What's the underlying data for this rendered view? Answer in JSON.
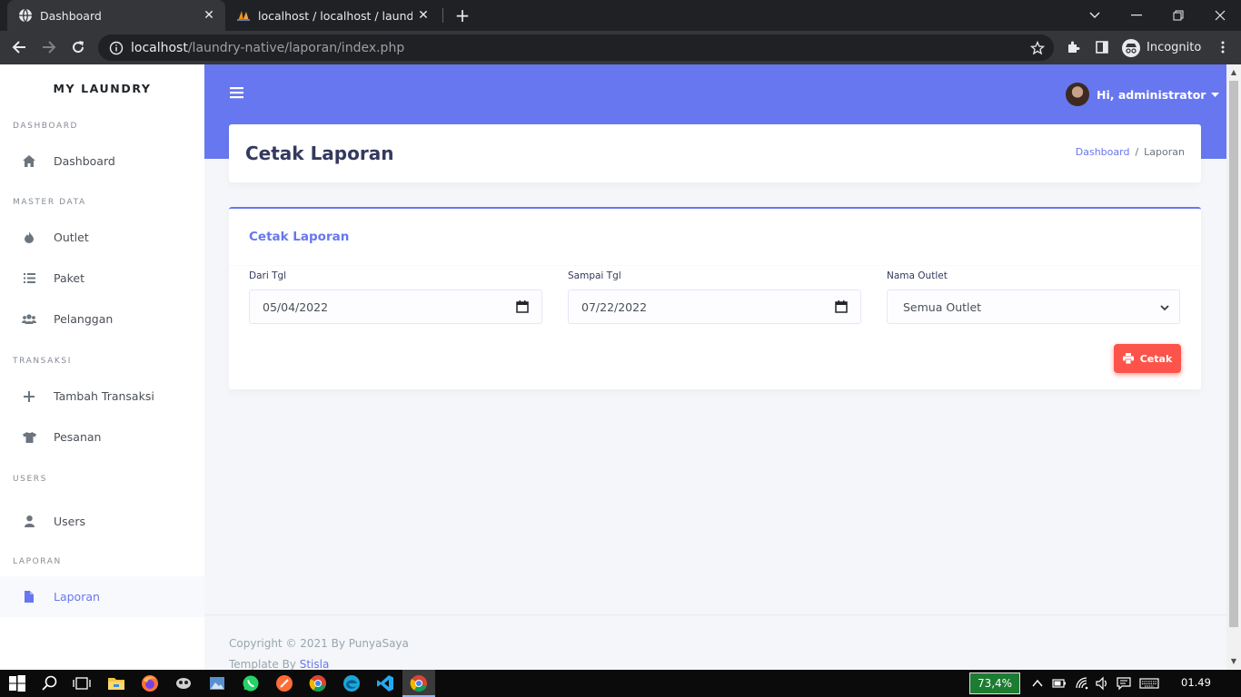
{
  "browser": {
    "tabs": [
      {
        "title": "Dashboard",
        "icon": "globe-icon",
        "active": true
      },
      {
        "title": "localhost / localhost / laundry-na",
        "icon": "phpmyadmin-icon",
        "active": false
      }
    ],
    "url_host": "localhost",
    "url_path": "/laundry-native/laporan/index.php",
    "profile_label": "Incognito"
  },
  "sidebar": {
    "brand": "MY LAUNDRY",
    "sections": {
      "dashboard": "DASHBOARD",
      "master_data": "MASTER DATA",
      "transaksi": "TRANSAKSI",
      "users": "USERS",
      "laporan": "LAPORAN"
    },
    "items": {
      "dashboard": "Dashboard",
      "outlet": "Outlet",
      "paket": "Paket",
      "pelanggan": "Pelanggan",
      "tambah_transaksi": "Tambah Transaksi",
      "pesanan": "Pesanan",
      "users": "Users",
      "laporan": "Laporan"
    }
  },
  "navbar": {
    "greeting": "Hi, administrator"
  },
  "section": {
    "title": "Cetak Laporan",
    "breadcrumb": {
      "home": "Dashboard",
      "sep": "/",
      "current": "Laporan"
    }
  },
  "card": {
    "title": "Cetak Laporan",
    "fields": {
      "from_label": "Dari Tgl",
      "from_value": "05/04/2022",
      "to_label": "Sampai Tgl",
      "to_value": "07/22/2022",
      "outlet_label": "Nama Outlet",
      "outlet_value": "Semua Outlet"
    },
    "print_label": "Cetak"
  },
  "footer": {
    "copyright": "Copyright © 2021 By PunyaSaya",
    "template_prefix": "Template By ",
    "template_link": "Stisla"
  },
  "taskbar": {
    "battery": "73,4%",
    "time": "01.49"
  },
  "colors": {
    "primary": "#6777ef",
    "danger": "#fc544b",
    "background": "#f4f6f9"
  }
}
